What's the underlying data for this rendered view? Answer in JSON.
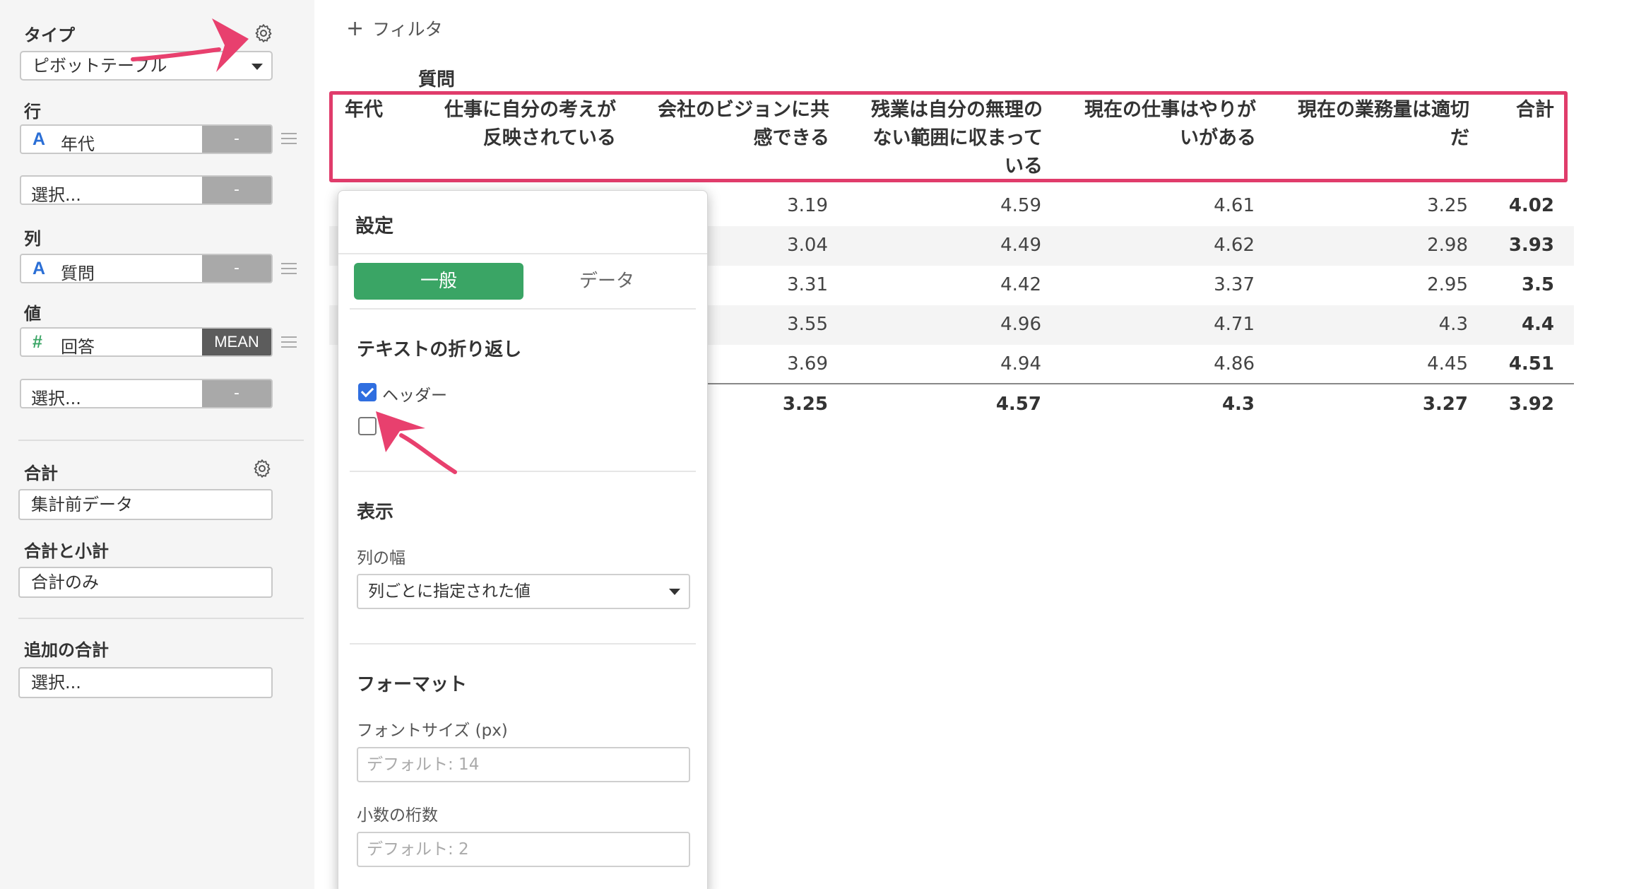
{
  "sidebar": {
    "type_label": "タイプ",
    "type_value": "ピボットテーブル",
    "rows_label": "行",
    "row_field": "年代",
    "row_field_btn": "-",
    "row_select_placeholder": "選択...",
    "row_select_btn": "-",
    "cols_label": "列",
    "col_field": "質問",
    "col_field_btn": "-",
    "values_label": "値",
    "value_field": "回答",
    "value_agg": "MEAN",
    "value_select_placeholder": "選択...",
    "value_select_btn": "-",
    "total_label": "合計",
    "total_value": "集計前データ",
    "subtotal_label": "合計と小計",
    "subtotal_value": "合計のみ",
    "extra_total_label": "追加の合計",
    "extra_total_placeholder": "選択...",
    "icons": {
      "string_type": "A",
      "number_type": "#",
      "accent_blue": "#2b6fd6",
      "accent_green": "#3aa565"
    }
  },
  "main": {
    "filter_label": "フィルタ",
    "filter_icon": "+",
    "column_group_label": "質問",
    "headers": [
      [
        "年代"
      ],
      [
        "仕事に自分の考えが",
        "反映されている"
      ],
      [
        "会社のビジョンに共",
        "感できる"
      ],
      [
        "残業は自分の無理の",
        "ない範囲に収まって",
        "いる"
      ],
      [
        "現在の仕事はやりが",
        "いがある"
      ],
      [
        "現在の業務量は適切",
        "だ"
      ],
      [
        "合計"
      ]
    ],
    "rows": [
      [
        "3.19",
        "4.59",
        "4.61",
        "3.25",
        "4.02"
      ],
      [
        "3.04",
        "4.49",
        "4.62",
        "2.98",
        "3.93"
      ],
      [
        "3.31",
        "4.42",
        "3.37",
        "2.95",
        "3.5"
      ],
      [
        "3.55",
        "4.96",
        "4.71",
        "4.3",
        "4.4"
      ],
      [
        "3.69",
        "4.94",
        "4.86",
        "4.45",
        "4.51"
      ]
    ],
    "totals": [
      "3.25",
      "4.57",
      "4.3",
      "3.27",
      "3.92"
    ],
    "highlight_color": "#e03c6b"
  },
  "settings": {
    "title": "設定",
    "tab_general": "一般",
    "tab_data": "データ",
    "wrap_heading": "テキストの折り返し",
    "header_checkbox_label": "ヘッダー",
    "header_checked": true,
    "second_checked": false,
    "display_heading": "表示",
    "col_width_label": "列の幅",
    "col_width_value": "列ごとに指定された値",
    "format_heading": "フォーマット",
    "font_size_label": "フォントサイズ (px)",
    "font_size_placeholder": "デフォルト: 14",
    "decimals_label": "小数の桁数",
    "decimals_placeholder": "デフォルト: 2"
  }
}
